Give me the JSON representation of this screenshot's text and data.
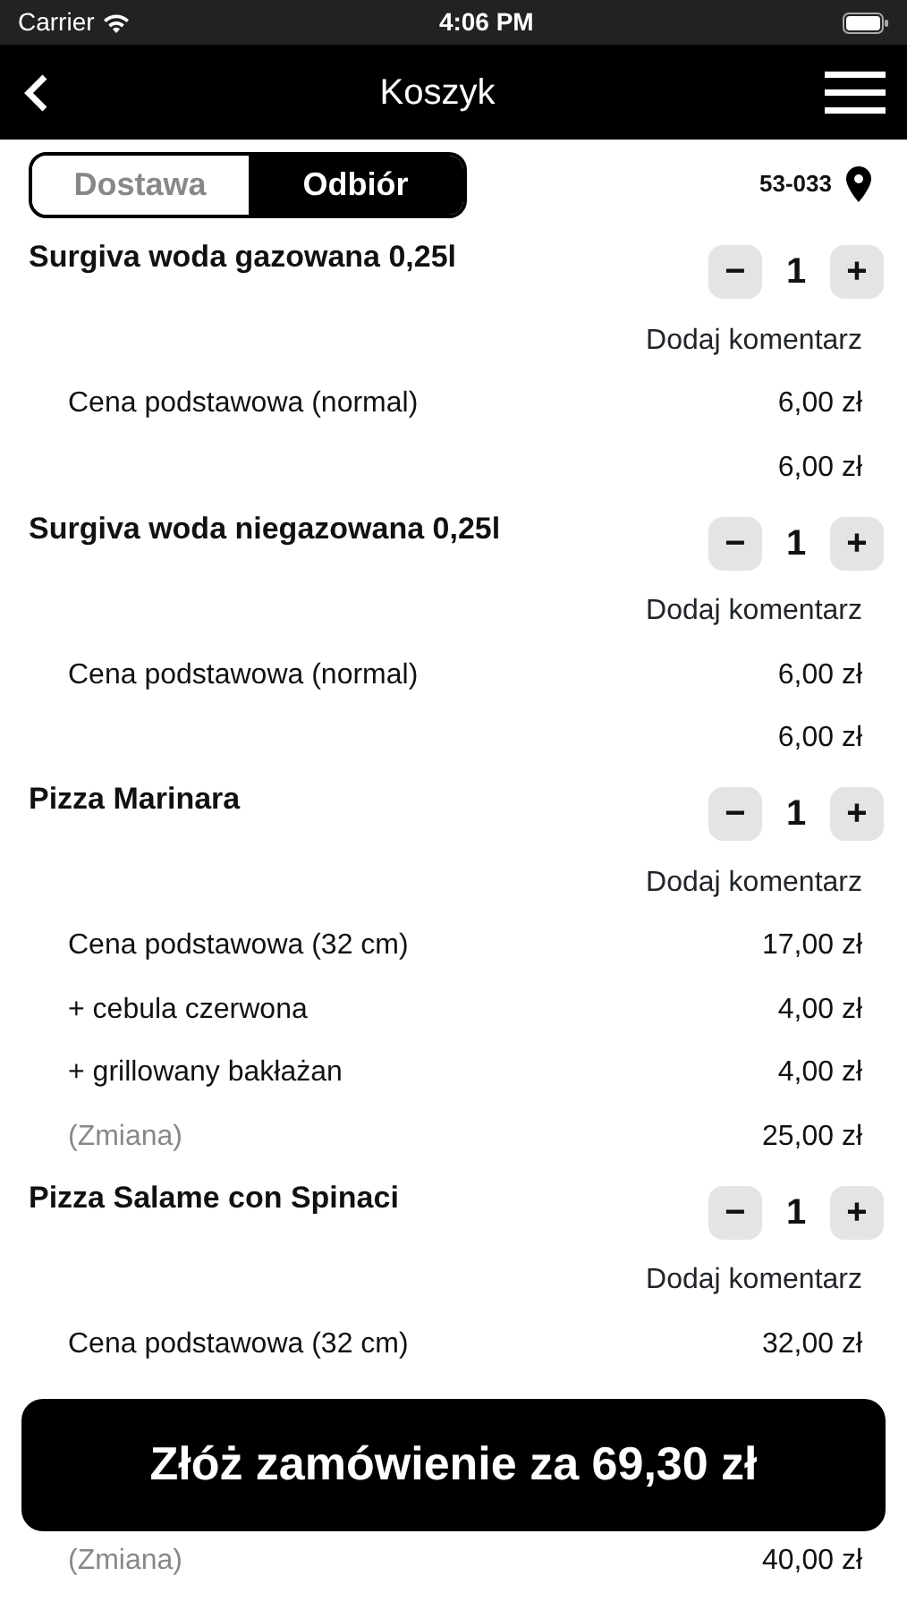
{
  "status_bar": {
    "carrier": "Carrier",
    "time": "4:06 PM"
  },
  "nav": {
    "title": "Koszyk"
  },
  "tabs": [
    {
      "label": "Dostawa",
      "selected": false
    },
    {
      "label": "Odbiór",
      "selected": true
    }
  ],
  "postal_code": "53-033",
  "items": [
    {
      "name": "Surgiva woda gazowana 0,25l",
      "minus": "−",
      "quantity": "1",
      "plus": "+",
      "comment_link": "Dodaj komentarz",
      "lines": [
        {
          "kind": "base",
          "label": "Cena podstawowa (normal)",
          "price": "6,00 zł"
        },
        {
          "kind": "subtotal",
          "price": "6,00 zł"
        }
      ]
    },
    {
      "name": "Surgiva woda niegazowana 0,25l",
      "minus": "−",
      "quantity": "1",
      "plus": "+",
      "comment_link": "Dodaj komentarz",
      "lines": [
        {
          "kind": "base",
          "label": "Cena podstawowa (normal)",
          "price": "6,00 zł"
        },
        {
          "kind": "subtotal",
          "price": "6,00 zł"
        }
      ]
    },
    {
      "name": "Pizza Marinara",
      "minus": "−",
      "quantity": "1",
      "plus": "+",
      "comment_link": "Dodaj komentarz",
      "lines": [
        {
          "kind": "base",
          "label": "Cena podstawowa (32 cm)",
          "price": "17,00 zł"
        },
        {
          "kind": "base",
          "label": "+ cebula czerwona",
          "price": "4,00 zł"
        },
        {
          "kind": "base",
          "label": "+ grillowany bakłażan",
          "price": "4,00 zł"
        },
        {
          "kind": "change",
          "label": "(Zmiana)",
          "price": "25,00 zł"
        }
      ]
    },
    {
      "name": "Pizza Salame con Spinaci",
      "minus": "−",
      "quantity": "1",
      "plus": "+",
      "comment_link": "Dodaj komentarz",
      "lines": [
        {
          "kind": "base",
          "label": "Cena podstawowa (32 cm)",
          "price": "32,00 zł"
        }
      ]
    }
  ],
  "order_button": "Złóż zamówienie za 69,30 zł",
  "trailing_line": {
    "kind": "change",
    "label": "(Zmiana)",
    "price": "40,00 zł"
  }
}
